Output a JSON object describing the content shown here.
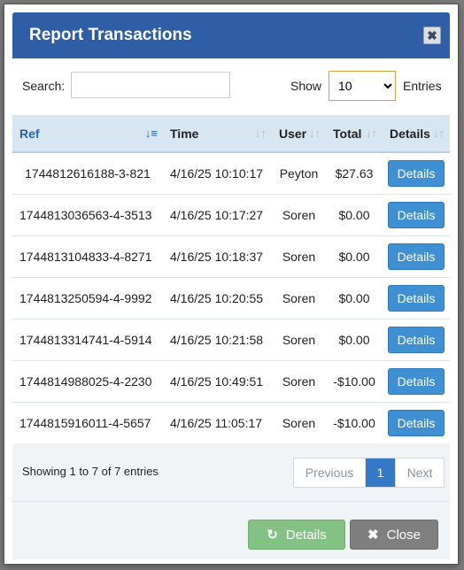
{
  "modal": {
    "title": "Report Transactions",
    "close_icon_glyph": "✖"
  },
  "controls": {
    "search_label": "Search:",
    "search_value": "",
    "show_label": "Show",
    "entries_selected": "10",
    "entries_label": "Entries"
  },
  "table": {
    "headers": {
      "ref": "Ref",
      "time": "Time",
      "user": "User",
      "total": "Total",
      "details": "Details"
    },
    "rows": [
      {
        "ref": "1744812616188-3-821",
        "time": "4/16/25 10:10:17",
        "user": "Peyton",
        "total": "$27.63",
        "action": "Details"
      },
      {
        "ref": "1744813036563-4-3513",
        "time": "4/16/25 10:17:27",
        "user": "Soren",
        "total": "$0.00",
        "action": "Details"
      },
      {
        "ref": "1744813104833-4-8271",
        "time": "4/16/25 10:18:37",
        "user": "Soren",
        "total": "$0.00",
        "action": "Details"
      },
      {
        "ref": "1744813250594-4-9992",
        "time": "4/16/25 10:20:55",
        "user": "Soren",
        "total": "$0.00",
        "action": "Details"
      },
      {
        "ref": "1744813314741-4-5914",
        "time": "4/16/25 10:21:58",
        "user": "Soren",
        "total": "$0.00",
        "action": "Details"
      },
      {
        "ref": "1744814988025-4-2230",
        "time": "4/16/25 10:49:51",
        "user": "Soren",
        "total": "-$10.00",
        "action": "Details"
      },
      {
        "ref": "1744815916011-4-5657",
        "time": "4/16/25 11:05:17",
        "user": "Soren",
        "total": "-$10.00",
        "action": "Details"
      }
    ]
  },
  "footer_info": "Showing 1 to 7 of 7 entries",
  "pagination": {
    "previous": "Previous",
    "current": "1",
    "next": "Next"
  },
  "buttons": {
    "details": "Details",
    "close": "Close"
  },
  "icons": {
    "sort_active": "sort-amount-down-icon",
    "sort_inactive": "sort-icon",
    "refresh": "refresh-icon",
    "close": "close-icon"
  },
  "colors": {
    "header_bg": "#2f5ea6",
    "button_blue": "#3f8fd3",
    "button_green": "#84c185",
    "button_gray": "#7f7f7f"
  }
}
